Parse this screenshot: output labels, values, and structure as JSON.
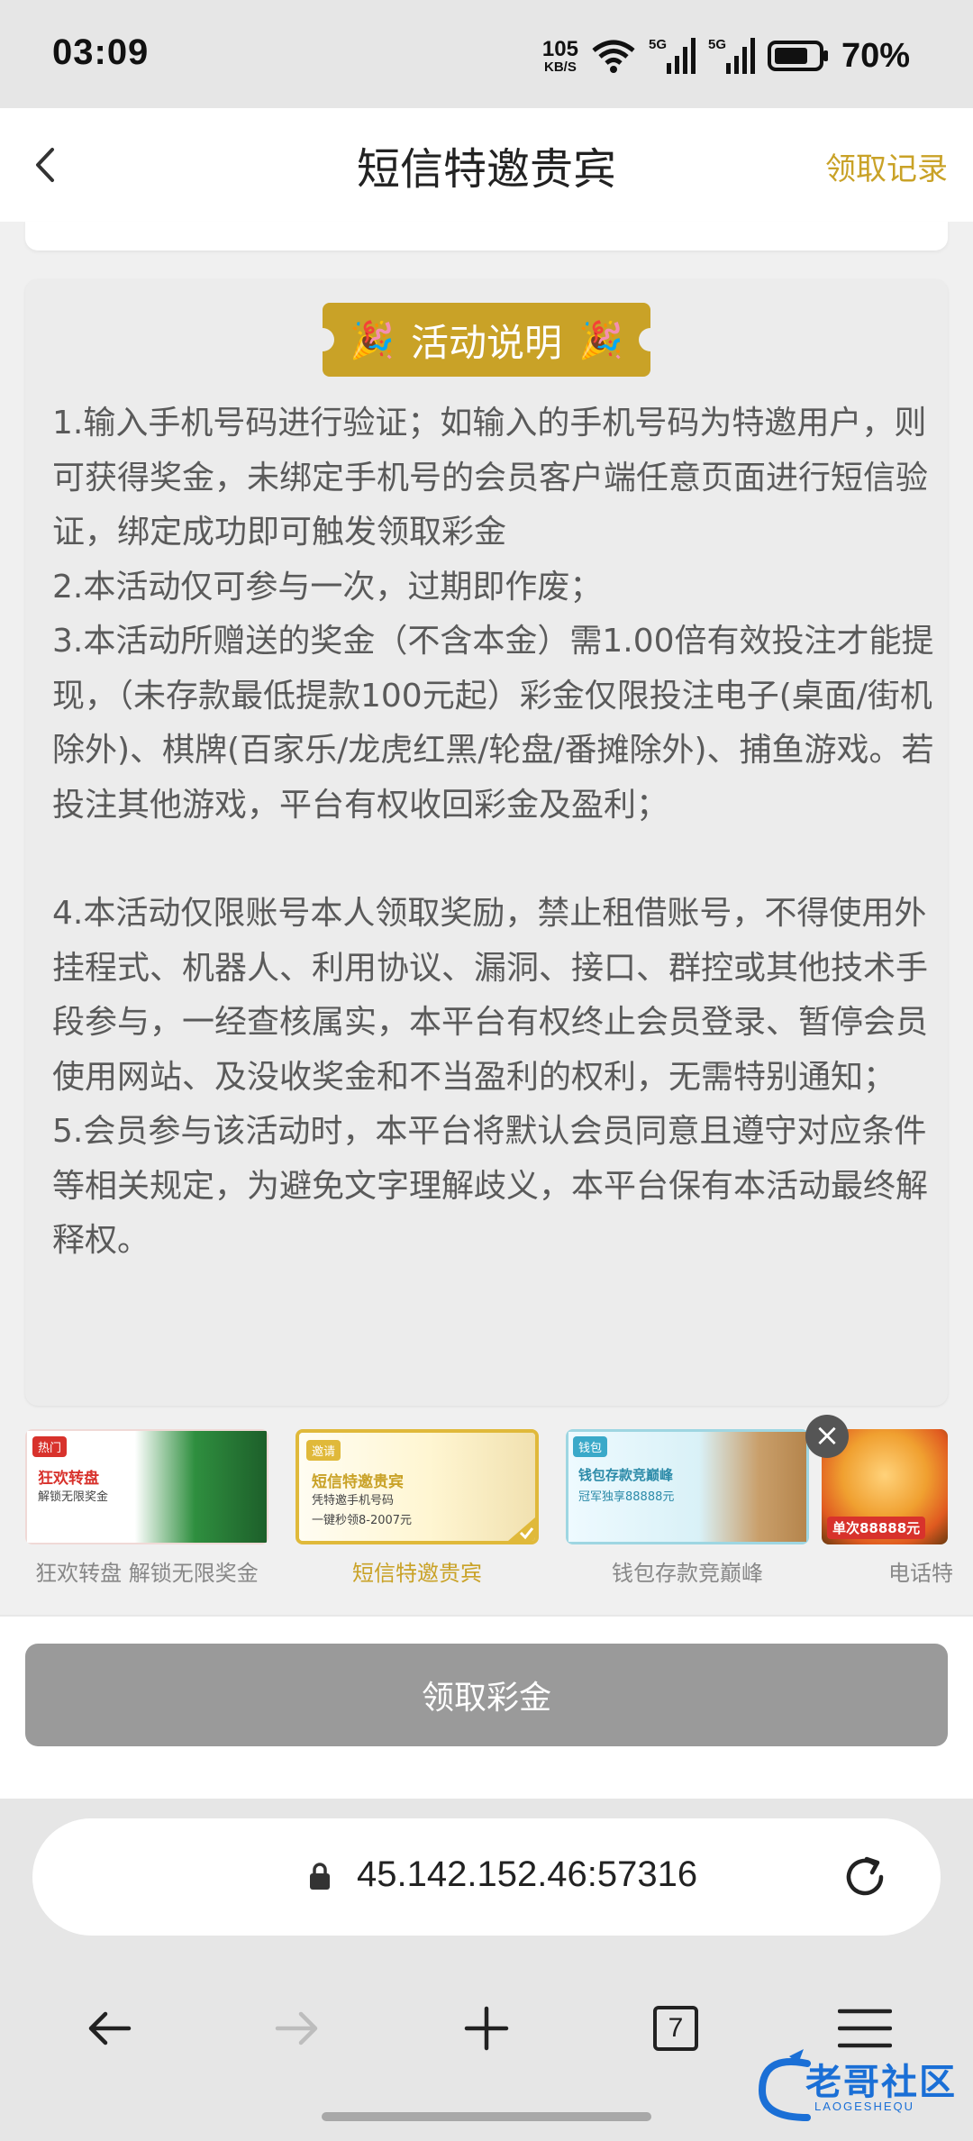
{
  "status_bar": {
    "time": "03:09",
    "net_speed_value": "105",
    "net_speed_unit": "KB/S",
    "signal_1": "5G",
    "signal_2": "5G",
    "battery": "70%"
  },
  "navbar": {
    "title": "短信特邀贵宾",
    "record_link": "领取记录"
  },
  "rules": {
    "badge": "活动说明",
    "paragraphs": [
      "1.输入手机号码进行验证；如输入的手机号码为特邀用户，则可获得奖金，未绑定手机号的会员客户端任意页面进行短信验证，绑定成功即可触发领取彩金",
      "2.本活动仅可参与一次，过期即作废；",
      "3.本活动所赠送的奖金（不含本金）需1.00倍有效投注才能提现，（未存款最低提款100元起）彩金仅限投注电子(桌面/街机除外)、棋牌(百家乐/龙虎红黑/轮盘/番摊除外)、捕鱼游戏。若投注其他游戏，平台有权收回彩金及盈利；",
      "4.本活动仅限账号本人领取奖励，禁止租借账号，不得使用外挂程式、机器人、利用协议、漏洞、接口、群控或其他技术手段参与，一经查核属实，本平台有权终止会员登录、暂停会员使用网站、及没收奖金和不当盈利的权利，无需特别通知；",
      "5.会员参与该活动时，本平台将默认会员同意且遵守对应条件等相关规定，为避免文字理解歧义，本平台保有本活动最终解释权。"
    ]
  },
  "tiles": [
    {
      "tag": "热门",
      "name": "狂欢转盘",
      "desc": "解锁无限奖金",
      "label": "狂欢转盘 解锁无限奖金"
    },
    {
      "tag": "邀请",
      "name": "短信特邀贵宾",
      "desc": "凭特邀手机号码",
      "desc2": "一键秒领8-2007元",
      "label": "短信特邀贵宾"
    },
    {
      "tag": "钱包",
      "name": "钱包存款竞巅峰",
      "desc": "冠军独享88888元",
      "label": "钱包存款竞巅峰"
    },
    {
      "badge": "单次88888元",
      "label": "电话特"
    }
  ],
  "claim_button": "领取彩金",
  "browser": {
    "url": "45.142.152.46:57316",
    "tab_count": "7"
  },
  "watermark": {
    "text": "老哥社区",
    "sub": "LAOGESHEQU"
  }
}
